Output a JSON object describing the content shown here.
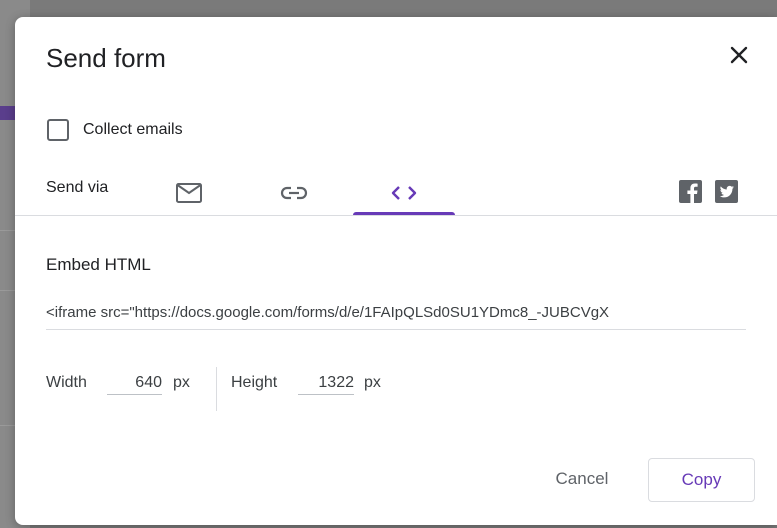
{
  "dialog": {
    "title": "Send form",
    "close_icon": "close-icon"
  },
  "collect_emails": {
    "label": "Collect emails",
    "checked": false
  },
  "send_via": {
    "label": "Send via",
    "tabs": [
      {
        "icon": "email-icon",
        "selected": false
      },
      {
        "icon": "link-icon",
        "selected": false
      },
      {
        "icon": "embed-code-icon",
        "selected": true
      }
    ],
    "social": [
      "facebook-icon",
      "twitter-icon"
    ],
    "accent_color": "#673ab7"
  },
  "embed": {
    "title": "Embed HTML",
    "code": "<iframe src=\"https://docs.google.com/forms/d/e/1FAIpQLSd0SU1YDmc8_-JUBCVgX",
    "width_label": "Width",
    "width_value": "640",
    "width_unit": "px",
    "height_label": "Height",
    "height_value": "1322",
    "height_unit": "px"
  },
  "actions": {
    "cancel_label": "Cancel",
    "copy_label": "Copy"
  }
}
